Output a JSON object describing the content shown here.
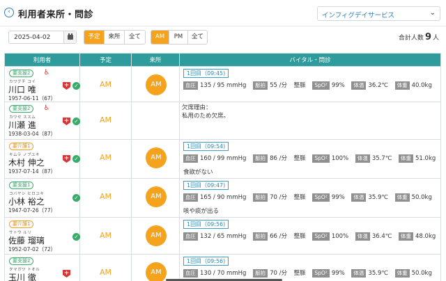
{
  "header": {
    "back_icon": "back-arrow-icon",
    "title": "利用者来所・問診",
    "facility": "インフィグデイサービス"
  },
  "filters": {
    "date": "2025-04-02",
    "type_buttons": [
      "予定",
      "来所",
      "全て"
    ],
    "time_buttons": [
      "AM",
      "PM",
      "全て"
    ]
  },
  "summary": {
    "label": "合計人数",
    "count": "9",
    "unit": "人"
  },
  "colors": {
    "accent": "#f5a21c",
    "header": "#2e9c9c",
    "support": "#3aaa6a",
    "care": "#f0a020"
  },
  "table": {
    "headers": [
      "利用者",
      "予定",
      "来所",
      "バイタル・問診"
    ],
    "rows": [
      {
        "badge": "要支援2",
        "kana": "カワグチ コイ",
        "name": "川口 唯",
        "dob": "1957-06-11（67）",
        "schedule": "AM",
        "attend": "AM",
        "visit": "1回目（09:45)",
        "vitals": [
          "血圧",
          "135 / 95 mmHg",
          "脈拍",
          "55 /分",
          "整脈",
          "SpO²",
          "99%",
          "体温",
          "36.2℃",
          "体重",
          "40.0kg"
        ],
        "note": ""
      },
      {
        "badge": "要支援2",
        "kana": "カワセ ススム",
        "name": "川瀬 進",
        "dob": "1938-03-04（87）",
        "schedule": "AM",
        "attend": "",
        "absence_label": "欠席理由：",
        "absence_reason": "私用のため欠席。"
      },
      {
        "badge": "要介護1",
        "kana": "キムラ ノブユキ",
        "name": "木村 伸之",
        "dob": "1937-07-14（87）",
        "schedule": "AM",
        "attend": "AM",
        "visit": "1回目（09:54)",
        "vitals": [
          "血圧",
          "160 / 99 mmHg",
          "脈拍",
          "86 /分",
          "整脈",
          "SpO²",
          "100%",
          "体温",
          "35.7℃",
          "体重",
          "51.0kg"
        ],
        "note": "食欲がない"
      },
      {
        "badge": "要支援1",
        "kana": "コバヤシ ヒロユキ",
        "name": "小林 裕之",
        "dob": "1947-07-26（77）",
        "schedule": "AM",
        "attend": "AM",
        "visit": "1回目（09:47)",
        "vitals": [
          "血圧",
          "165 / 90 mmHg",
          "脈拍",
          "70 /分",
          "整脈",
          "SpO²",
          "99%",
          "体温",
          "35.9℃",
          "体重",
          "50.0kg"
        ],
        "note": "咳や痰が出る"
      },
      {
        "badge": "要介護1",
        "kana": "サトウ ルリ",
        "name": "佐藤 瑠璃",
        "dob": "1952-07-02（72）",
        "schedule": "AM",
        "attend": "AM",
        "visit": "1回目（09:56)",
        "vitals": [
          "血圧",
          "132 / 65 mmHg",
          "脈拍",
          "66 /分",
          "整脈",
          "SpO²",
          "100%",
          "体温",
          "36.4℃",
          "体重",
          "48.0kg"
        ],
        "note": ""
      },
      {
        "badge": "要支援2",
        "kana": "タマガワ トオル",
        "name": "玉川 徹",
        "dob": "",
        "schedule": "AM",
        "attend": "AM",
        "visit": "1回目（09:56)",
        "vitals": [
          "血圧",
          "130 / 70 mmHg",
          "脈拍",
          "70 /分",
          "整脈",
          "SpO²",
          "99%",
          "体温",
          "35.9℃",
          "体重",
          "50.0kg"
        ],
        "note": ""
      }
    ]
  }
}
